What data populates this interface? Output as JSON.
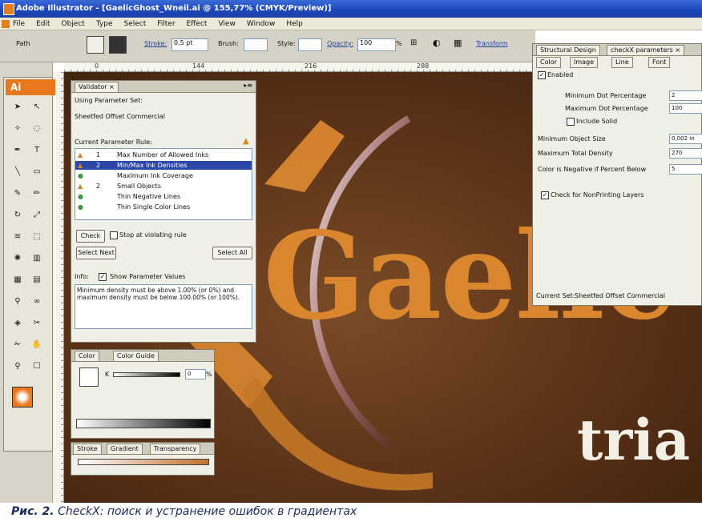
{
  "window": {
    "title": "Adobe Illustrator - [GaelicGhost_Wneil.ai @ 155,77% (CMYK/Preview)]"
  },
  "menubar": {
    "items": [
      "File",
      "Edit",
      "Object",
      "Type",
      "Select",
      "Filter",
      "Effect",
      "View",
      "Window",
      "Help"
    ]
  },
  "controlbar": {
    "path_label": "Path",
    "stroke_label": "Stroke:",
    "stroke_value": "0,5 pt",
    "brush_label": "Brush:",
    "style_label": "Style:",
    "opacity_label": "Opacity:",
    "opacity_value": "100",
    "opacity_unit": "%",
    "transform_label": "Transform"
  },
  "ruler": {
    "marks": [
      "0",
      "144",
      "216",
      "288"
    ]
  },
  "validator": {
    "tab": "Validator",
    "using_label": "Using Parameter Set:",
    "parameter_set": "Sheetfed Offset Commercial",
    "current_label": "Current Parameter Rule:",
    "rules": [
      {
        "num": "1",
        "text": "Max Number of Allowed Inks",
        "status": "warn"
      },
      {
        "num": "2",
        "text": "Min/Max Ink Densities",
        "status": "warn",
        "selected": true
      },
      {
        "num": "",
        "text": "Maximum Ink Coverage",
        "status": "ok"
      },
      {
        "num": "2",
        "text": "Small Objects",
        "status": "warn"
      },
      {
        "num": "",
        "text": "Thin Negative Lines",
        "status": "ok"
      },
      {
        "num": "",
        "text": "Thin Single Color Lines",
        "status": "ok"
      }
    ],
    "check_button": "Check",
    "stop_label": "Stop at violating rule",
    "select_next": "Select Next",
    "select_all": "Select All",
    "info_label": "Info:",
    "show_values_label": "Show Parameter Values",
    "info_text": "Minimum density must be above 1.00% (or 0%) and maximum density must be below 100.00% (or 100%)."
  },
  "color_panel": {
    "tabs": [
      "Color",
      "Color Guide"
    ],
    "k_label": "K",
    "k_value": "0",
    "k_unit": "%"
  },
  "stroke_panel": {
    "tabs": [
      "Stroke",
      "Gradient",
      "Transparency"
    ]
  },
  "right_panel": {
    "tabs": [
      "Structural Design",
      "checkX parameters"
    ],
    "subtabs": [
      "Color",
      "Image",
      "Line",
      "Font"
    ],
    "enabled_label": "Enabled",
    "min_dot_label": "Minimum Dot Percentage",
    "min_dot_value": "2",
    "max_dot_label": "Maximum Dot Percentage",
    "max_dot_value": "100",
    "include_solid_label": "Include Solid",
    "min_object_label": "Minimum Object Size",
    "min_object_value": "0,002 in",
    "max_density_label": "Maximum Total Density",
    "max_density_value": "270",
    "negative_label": "Color is Negative if Percent Below",
    "negative_value": "5",
    "nonprinting_label": "Check for NonPrinting Layers",
    "current_set_label": "Current Set:",
    "current_set_value": "Sheetfed Offset Commercial"
  },
  "artwork": {
    "word1": "Gaelic",
    "word2": "tria"
  },
  "caption": {
    "prefix": "Рис. 2.",
    "text": " CheckX: поиск и устранение ошибок в градиентах"
  },
  "colors": {
    "orange": "#d9862f",
    "canvas": "#5a3217",
    "selection": "#2b47a8"
  }
}
